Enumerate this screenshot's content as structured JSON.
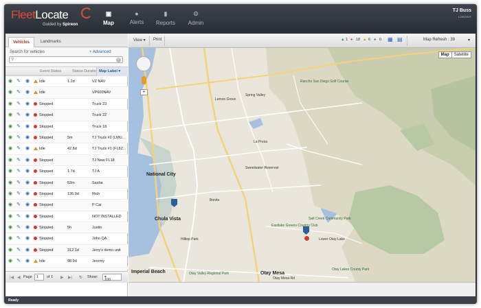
{
  "app": {
    "logo_part1": "Fleet",
    "logo_part2": "Locate",
    "guided_by": "Guided by",
    "brand": "Spireon"
  },
  "nav": [
    {
      "label": "Map",
      "icon": "map-icon",
      "active": true
    },
    {
      "label": "Alerts",
      "icon": "bell-icon",
      "active": false
    },
    {
      "label": "Reports",
      "icon": "bar-chart-icon",
      "active": false
    },
    {
      "label": "Admin",
      "icon": "gear-icon",
      "active": false
    }
  ],
  "user": {
    "name": "TJ Buss",
    "logout": "LOGOUT"
  },
  "left_tabs": [
    "Vehicles",
    "Landmarks"
  ],
  "search": {
    "label": "Search for vehicles",
    "advanced": "+ Advanced",
    "value": ""
  },
  "table": {
    "headers": [
      "Event Status",
      "Status Duratio",
      "Map Label"
    ],
    "rows": [
      {
        "status": "Idle",
        "dur": "1.2d",
        "label": "VZ NAV"
      },
      {
        "status": "Idle",
        "dur": "",
        "label": "VP600NAV"
      },
      {
        "status": "Stopped",
        "dur": "",
        "label": "Truck 23"
      },
      {
        "status": "Stopped",
        "dur": "",
        "label": "Truck 22"
      },
      {
        "status": "Stopped",
        "dur": "",
        "label": "Truck 18"
      },
      {
        "status": "Stopped",
        "dur": "5m",
        "label": "TJ Truck #2 (LMU..."
      },
      {
        "status": "Idle",
        "dur": "42.8d",
        "label": "TJ Truck #1 (FL8Z..."
      },
      {
        "status": "Stopped",
        "dur": "",
        "label": "TJ New FL18"
      },
      {
        "status": "Stopped",
        "dur": "1.7d",
        "label": "TJ A"
      },
      {
        "status": "Stopped",
        "dur": "52m",
        "label": "Sasha"
      },
      {
        "status": "Stopped",
        "dur": "136.9d",
        "label": "Rich"
      },
      {
        "status": "Stopped",
        "dur": "",
        "label": "P Car"
      },
      {
        "status": "Stopped",
        "dur": "",
        "label": "NOT INSTALLED"
      },
      {
        "status": "Stopped",
        "dur": "5h",
        "label": "Justin"
      },
      {
        "status": "Stopped",
        "dur": "",
        "label": "John QA"
      },
      {
        "status": "Stopped",
        "dur": "312.1d",
        "label": "Jerry's demo unit"
      },
      {
        "status": "Idle",
        "dur": "98.9d",
        "label": "Jeremy"
      },
      {
        "status": "Stopped",
        "dur": "7.2h",
        "label": "Jeff Taurus"
      }
    ]
  },
  "pager": {
    "page_label": "Page",
    "page": "1",
    "of": "of 1",
    "show_label": "Show:",
    "show": "100"
  },
  "map_toolbar": {
    "view": "View",
    "print": "Print",
    "counts": [
      "1",
      "18",
      "6",
      "0"
    ],
    "refresh": "Map Refresh : 39"
  },
  "map_type": [
    "Map",
    "Satellite"
  ],
  "map_labels": [
    {
      "t": "Lemon Grove"
    },
    {
      "t": "Spring Valley"
    },
    {
      "t": "National City"
    },
    {
      "t": "Chula Vista"
    },
    {
      "t": "Bonita"
    },
    {
      "t": "La Presa"
    },
    {
      "t": "Imperial Beach"
    },
    {
      "t": "Otay Mesa"
    },
    {
      "t": "Otay Mesa Rd"
    },
    {
      "t": "Hilltop Park"
    },
    {
      "t": "Lower Otay Lake"
    },
    {
      "t": "Otay Lakes County Park"
    },
    {
      "t": "Salt Creek Community Park"
    },
    {
      "t": "Eastlake Greens Country Club"
    },
    {
      "t": "Sweetwater Reservoir"
    },
    {
      "t": "Otay Valley Regional Park"
    },
    {
      "t": "Rancho San Diego Golf Course"
    }
  ],
  "status_bar": "Ready",
  "colors": {
    "stopped": "#d9342b",
    "idle": "#e58a1f",
    "accent": "#2458a8"
  }
}
